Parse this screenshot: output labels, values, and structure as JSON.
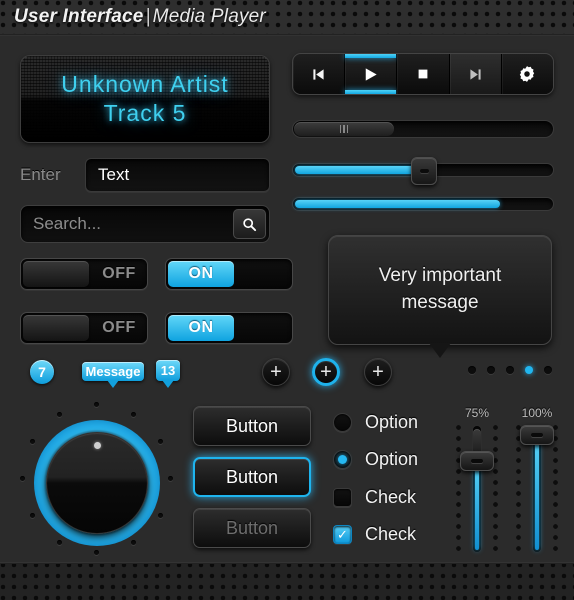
{
  "header": {
    "title_bold": "User Interface",
    "separator": "|",
    "title_light": "Media Player"
  },
  "display": {
    "line1": "Unknown Artist",
    "line2": "Track 5"
  },
  "form": {
    "enter_label": "Enter",
    "text_value": "Text",
    "search_placeholder": "Search...",
    "search_icon": "search-icon"
  },
  "transport": {
    "buttons": [
      {
        "name": "previous-track",
        "icon": "skip-back-icon",
        "state": "normal"
      },
      {
        "name": "play",
        "icon": "play-icon",
        "state": "active"
      },
      {
        "name": "stop",
        "icon": "stop-icon",
        "state": "normal"
      },
      {
        "name": "next-track",
        "icon": "skip-forward-icon",
        "state": "dim"
      },
      {
        "name": "settings",
        "icon": "gear-icon",
        "state": "normal"
      }
    ]
  },
  "sliders": {
    "progress_scrubber": {
      "name": "progress-bar",
      "value_pct": 35
    },
    "volume_slider": {
      "name": "volume-slider",
      "value_pct": 50
    },
    "level_bar": {
      "name": "level-bar",
      "value_pct": 80
    }
  },
  "toggles": [
    {
      "name": "toggle-off-1",
      "label": "OFF",
      "on": false
    },
    {
      "name": "toggle-on-1",
      "label": "ON",
      "on": true
    },
    {
      "name": "toggle-off-2",
      "label": "OFF",
      "on": false
    },
    {
      "name": "toggle-on-2",
      "label": "ON",
      "on": true
    }
  ],
  "badges": {
    "count_round": "7",
    "message_bubble": "Message",
    "count_bubble": "13"
  },
  "plus_buttons": [
    {
      "name": "add-button-1",
      "glyph": "+",
      "highlighted": false
    },
    {
      "name": "add-button-2",
      "glyph": "+",
      "highlighted": true
    },
    {
      "name": "add-button-3",
      "glyph": "+",
      "highlighted": false
    }
  ],
  "pagination": {
    "total": 5,
    "active_index": 3
  },
  "tooltip": {
    "line1": "Very important",
    "line2": "message"
  },
  "knob": {
    "name": "volume-knob",
    "tick_count": 12,
    "ring_color": "#2ab8f2"
  },
  "buttons": [
    {
      "name": "button-default",
      "label": "Button",
      "state": "normal"
    },
    {
      "name": "button-focused",
      "label": "Button",
      "state": "focused"
    },
    {
      "name": "button-disabled",
      "label": "Button",
      "state": "disabled"
    }
  ],
  "options": [
    {
      "type": "radio",
      "label": "Option",
      "checked": false
    },
    {
      "type": "radio",
      "label": "Option",
      "checked": true
    },
    {
      "type": "checkbox",
      "label": "Check",
      "checked": false
    },
    {
      "type": "checkbox",
      "label": "Check",
      "checked": true,
      "mark": "✓"
    }
  ],
  "vertical_sliders": [
    {
      "name": "vertical-slider-75",
      "label": "75%",
      "value_pct": 75
    },
    {
      "name": "vertical-slider-100",
      "label": "100%",
      "value_pct": 100
    }
  ],
  "colors": {
    "accent": "#21b6ef",
    "accent_light": "#5ad4f7",
    "background": "#2b2b2b",
    "panel": "#0a0a0a",
    "lcd_text": "#3fd0ef",
    "text": "#f2f2f2",
    "text_muted": "#8a8a8a"
  }
}
